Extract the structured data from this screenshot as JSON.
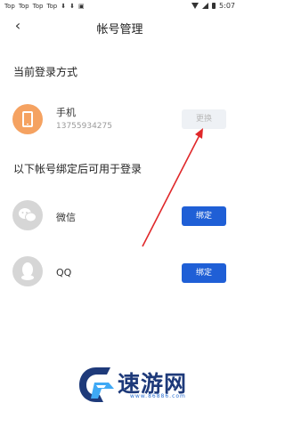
{
  "status_bar": {
    "left_labels": [
      "Top",
      "Top",
      "Top",
      "Top"
    ],
    "time": "5:07"
  },
  "nav": {
    "title": "帐号管理"
  },
  "current_login": {
    "section_title": "当前登录方式",
    "method_title": "手机",
    "phone_number": "13755934275",
    "change_button": "更换"
  },
  "bindings": {
    "section_title": "以下帐号绑定后可用于登录",
    "items": [
      {
        "label": "微信",
        "button": "绑定"
      },
      {
        "label": "QQ",
        "button": "绑定"
      }
    ]
  },
  "watermark": {
    "text": "速游网",
    "url": "www.86886.com"
  },
  "colors": {
    "accent_blue": "#1f5fd6",
    "phone_avatar": "#f5a261",
    "annotation_arrow": "#e0282a"
  }
}
